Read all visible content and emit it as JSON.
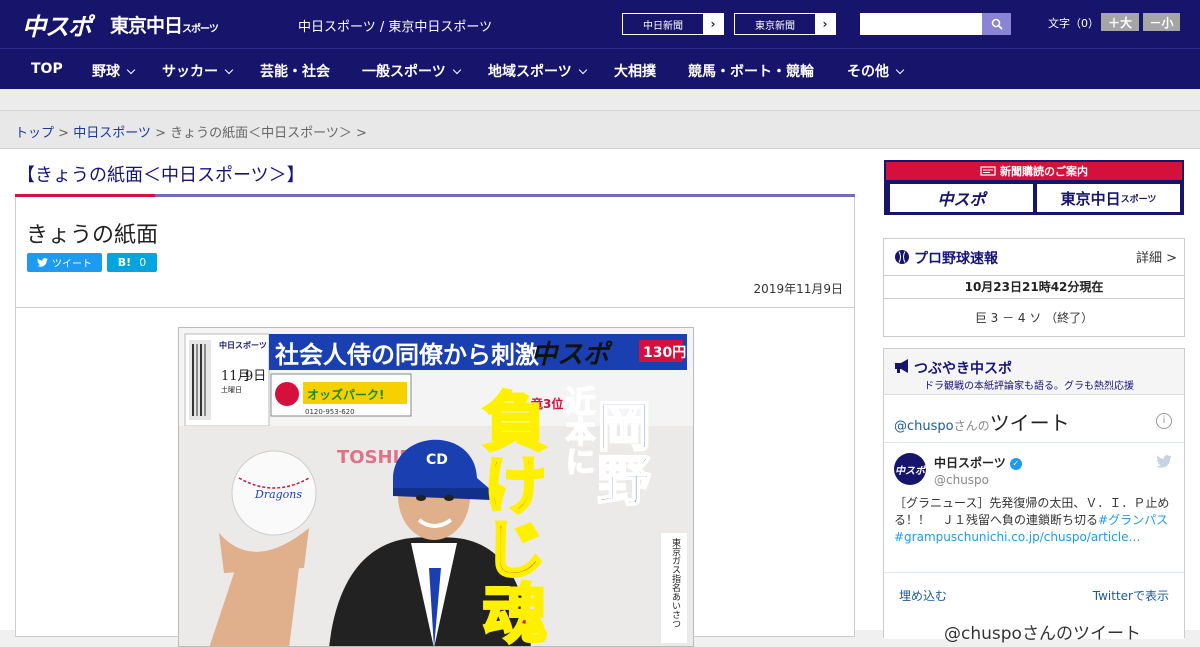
{
  "header": {
    "logo_chuspo": "中スポ",
    "logo_tokyo": "東京中日",
    "logo_tokyo_small": "スポーツ",
    "site_names": "中日スポーツ / 東京中日スポーツ",
    "paper_link_1": "中日新聞",
    "paper_link_2": "東京新聞",
    "arrow": "›",
    "search_placeholder": "",
    "fontsize_label": "文字（0）",
    "font_larger": "＋大",
    "font_smaller": "－小",
    "colors": {
      "navy": "#17146c",
      "red": "#d6103c"
    }
  },
  "nav": {
    "items": [
      {
        "label": "TOP"
      },
      {
        "label": "野球"
      },
      {
        "label": "サッカー"
      },
      {
        "label": "芸能・社会"
      },
      {
        "label": "一般スポーツ"
      },
      {
        "label": "地域スポーツ"
      },
      {
        "label": "大相撲"
      },
      {
        "label": "競馬・ボート・競輪"
      },
      {
        "label": "その他"
      }
    ]
  },
  "breadcrumb": {
    "top": "トップ",
    "sep": " > ",
    "section": "中日スポーツ",
    "current": "きょうの紙面＜中日スポーツ＞",
    "end": " >"
  },
  "main": {
    "page_title": "【きょうの紙面＜中日スポーツ＞】",
    "article_title": "きょうの紙面",
    "tweet_label": "ツイート",
    "hatena_label": "B!",
    "hatena_count": "0",
    "date": "2019年11月9日",
    "paper": {
      "masthead": "中日スポーツ",
      "date_month": "11月",
      "date_day": "9日",
      "weekday": "土曜日",
      "headline_top": "社会人侍の同僚から刺激",
      "brand": "中スポ",
      "price": "130円",
      "ad_text": "オッズパーク!",
      "ad_phone": "0120-953-620",
      "rank": "竜3位",
      "name": "岡野",
      "sub_headline": "近本に",
      "big_text": "負けじ魂",
      "sponsor": "TOSHIBA",
      "side_text": "東京ガス指名あいさつ",
      "cap_logo": "CD",
      "ball_text": "Dragons"
    }
  },
  "sidebar": {
    "promo_title": "新聞購読のご案内",
    "promo_logo_1": "中スポ",
    "promo_logo_2": "東京中日",
    "promo_logo_2_small": "スポーツ",
    "baseball": {
      "title": "プロ野球速報",
      "detail": "詳細 >",
      "time": "10月23日21時42分現在",
      "score": "巨 3 － 4 ソ （終了）"
    },
    "tsubuyaki": {
      "title": "つぶやき中スポ",
      "subtitle": "ドラ観戦の本紙評論家も語る。グラも熱烈応援",
      "tw_header_handle": "@chuspo",
      "tw_header_san": "さんの",
      "tw_header_tweet": "ツイート",
      "info": "i",
      "account_name": "中日スポーツ",
      "account_handle": "@chuspo",
      "avatar_text": "中スポ",
      "verified": "✓",
      "tweet_text": "［グラニュース］先発復帰の太田、Ｖ．Ｉ．Ｐ止める！！　Ｊ１残留へ負の連鎖断ち切る",
      "tweet_tag": "#グランパス",
      "tweet_link": "#grampuschunichi.co.jp/chuspo/article…",
      "embed_link": "埋め込む",
      "view_link": "Twitterで表示",
      "footer": "@chuspoさんのツイート"
    }
  }
}
